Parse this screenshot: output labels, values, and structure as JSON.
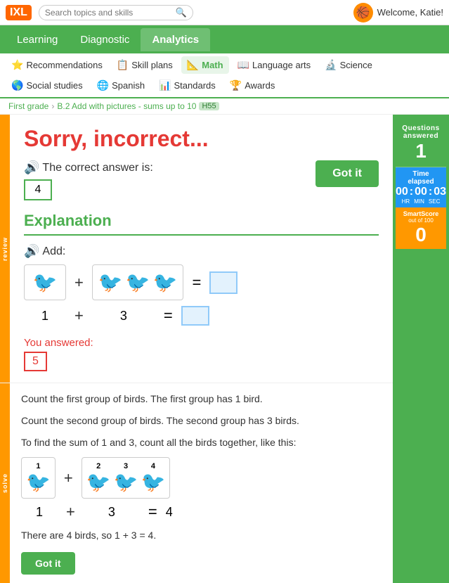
{
  "topbar": {
    "logo": "IXL",
    "search_placeholder": "Search topics and skills",
    "welcome": "Welcome, Katie!"
  },
  "nav": {
    "tabs": [
      "Learning",
      "Diagnostic",
      "Analytics"
    ],
    "active": "Learning"
  },
  "subjects": [
    {
      "label": "Recommendations",
      "icon": "⭐",
      "active": false
    },
    {
      "label": "Skill plans",
      "icon": "📋",
      "active": false
    },
    {
      "label": "Math",
      "icon": "📐",
      "active": true
    },
    {
      "label": "Language arts",
      "icon": "📖",
      "active": false
    },
    {
      "label": "Science",
      "icon": "🔬",
      "active": false
    },
    {
      "label": "Social studies",
      "icon": "🌎",
      "active": false
    },
    {
      "label": "Spanish",
      "icon": "🌐",
      "active": false
    },
    {
      "label": "Standards",
      "icon": "📊",
      "active": false
    },
    {
      "label": "Awards",
      "icon": "🏆",
      "active": false
    }
  ],
  "breadcrumb": {
    "level": "First grade",
    "skill_name": "B.2 Add with pictures - sums up to 10",
    "skill_code": "H55"
  },
  "main": {
    "feedback_title": "Sorry, incorrect...",
    "correct_answer_label": "The correct answer is:",
    "correct_answer_value": "4",
    "got_it_label": "Got it",
    "explanation_title": "Explanation",
    "add_label": "Add:",
    "first_group_count": 1,
    "second_group_count": 3,
    "you_answered_label": "You answered:",
    "user_answer": "5",
    "steps": [
      "Count the first group of birds. The first group has 1 bird.",
      "Count the second group of birds. The second group has 3 birds.",
      "To find the sum of 1 and 3, count all the birds together, like this:"
    ],
    "final_text": "There are 4 birds, so 1 + 3 = 4.",
    "bottom_got_it_label": "Got it"
  },
  "stats": {
    "questions_answered_label": "Questions\nanswered",
    "questions_answered_value": "1",
    "time_elapsed_label": "Time\nelapsed",
    "hr": "00",
    "min": "00",
    "sec": "03",
    "hr_label": "HR",
    "min_label": "MIN",
    "sec_label": "SEC",
    "smart_score_label": "SmartScore",
    "smart_score_sublabel": "out of 100",
    "smart_score_value": "0"
  },
  "review_tab_label": "review",
  "solve_tab_label": "solve"
}
